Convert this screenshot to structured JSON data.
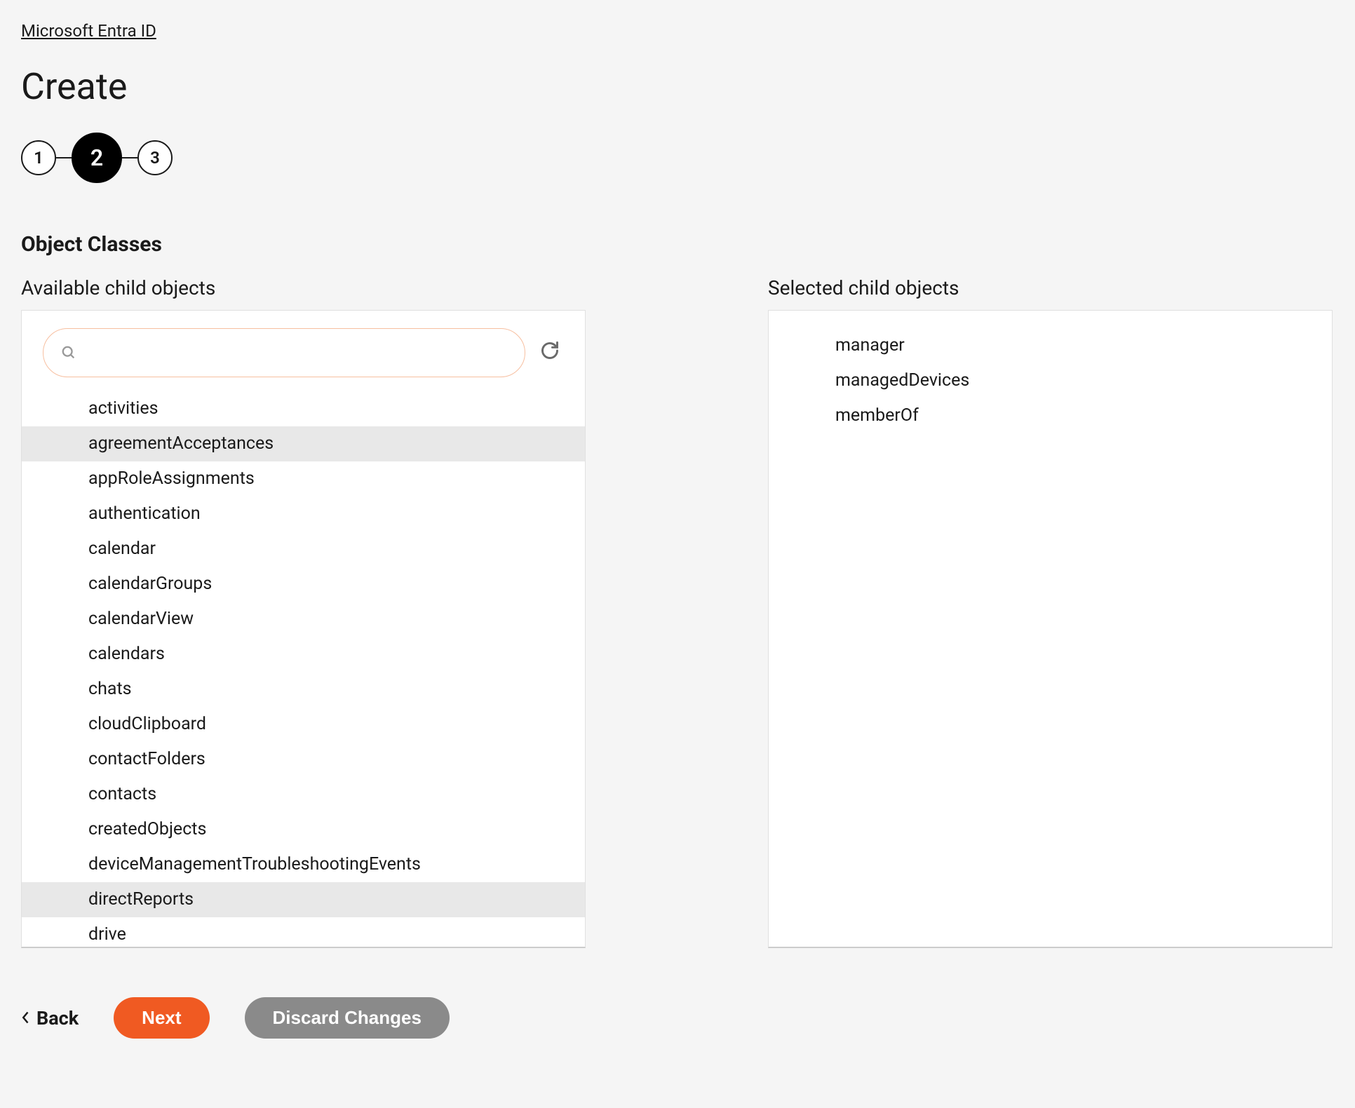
{
  "breadcrumb": {
    "label": "Microsoft Entra ID"
  },
  "page": {
    "title": "Create"
  },
  "stepper": {
    "steps": [
      "1",
      "2",
      "3"
    ],
    "activeIndex": 1
  },
  "section": {
    "heading": "Object Classes"
  },
  "available": {
    "label": "Available child objects",
    "search": {
      "value": "",
      "placeholder": ""
    },
    "items": [
      {
        "label": "activities",
        "highlighted": false
      },
      {
        "label": "agreementAcceptances",
        "highlighted": true
      },
      {
        "label": "appRoleAssignments",
        "highlighted": false
      },
      {
        "label": "authentication",
        "highlighted": false
      },
      {
        "label": "calendar",
        "highlighted": false
      },
      {
        "label": "calendarGroups",
        "highlighted": false
      },
      {
        "label": "calendarView",
        "highlighted": false
      },
      {
        "label": "calendars",
        "highlighted": false
      },
      {
        "label": "chats",
        "highlighted": false
      },
      {
        "label": "cloudClipboard",
        "highlighted": false
      },
      {
        "label": "contactFolders",
        "highlighted": false
      },
      {
        "label": "contacts",
        "highlighted": false
      },
      {
        "label": "createdObjects",
        "highlighted": false
      },
      {
        "label": "deviceManagementTroubleshootingEvents",
        "highlighted": false
      },
      {
        "label": "directReports",
        "highlighted": true
      },
      {
        "label": "drive",
        "highlighted": false
      }
    ]
  },
  "selected": {
    "label": "Selected child objects",
    "items": [
      {
        "label": "manager"
      },
      {
        "label": "managedDevices"
      },
      {
        "label": "memberOf"
      }
    ]
  },
  "footer": {
    "back": "Back",
    "next": "Next",
    "discard": "Discard Changes"
  }
}
